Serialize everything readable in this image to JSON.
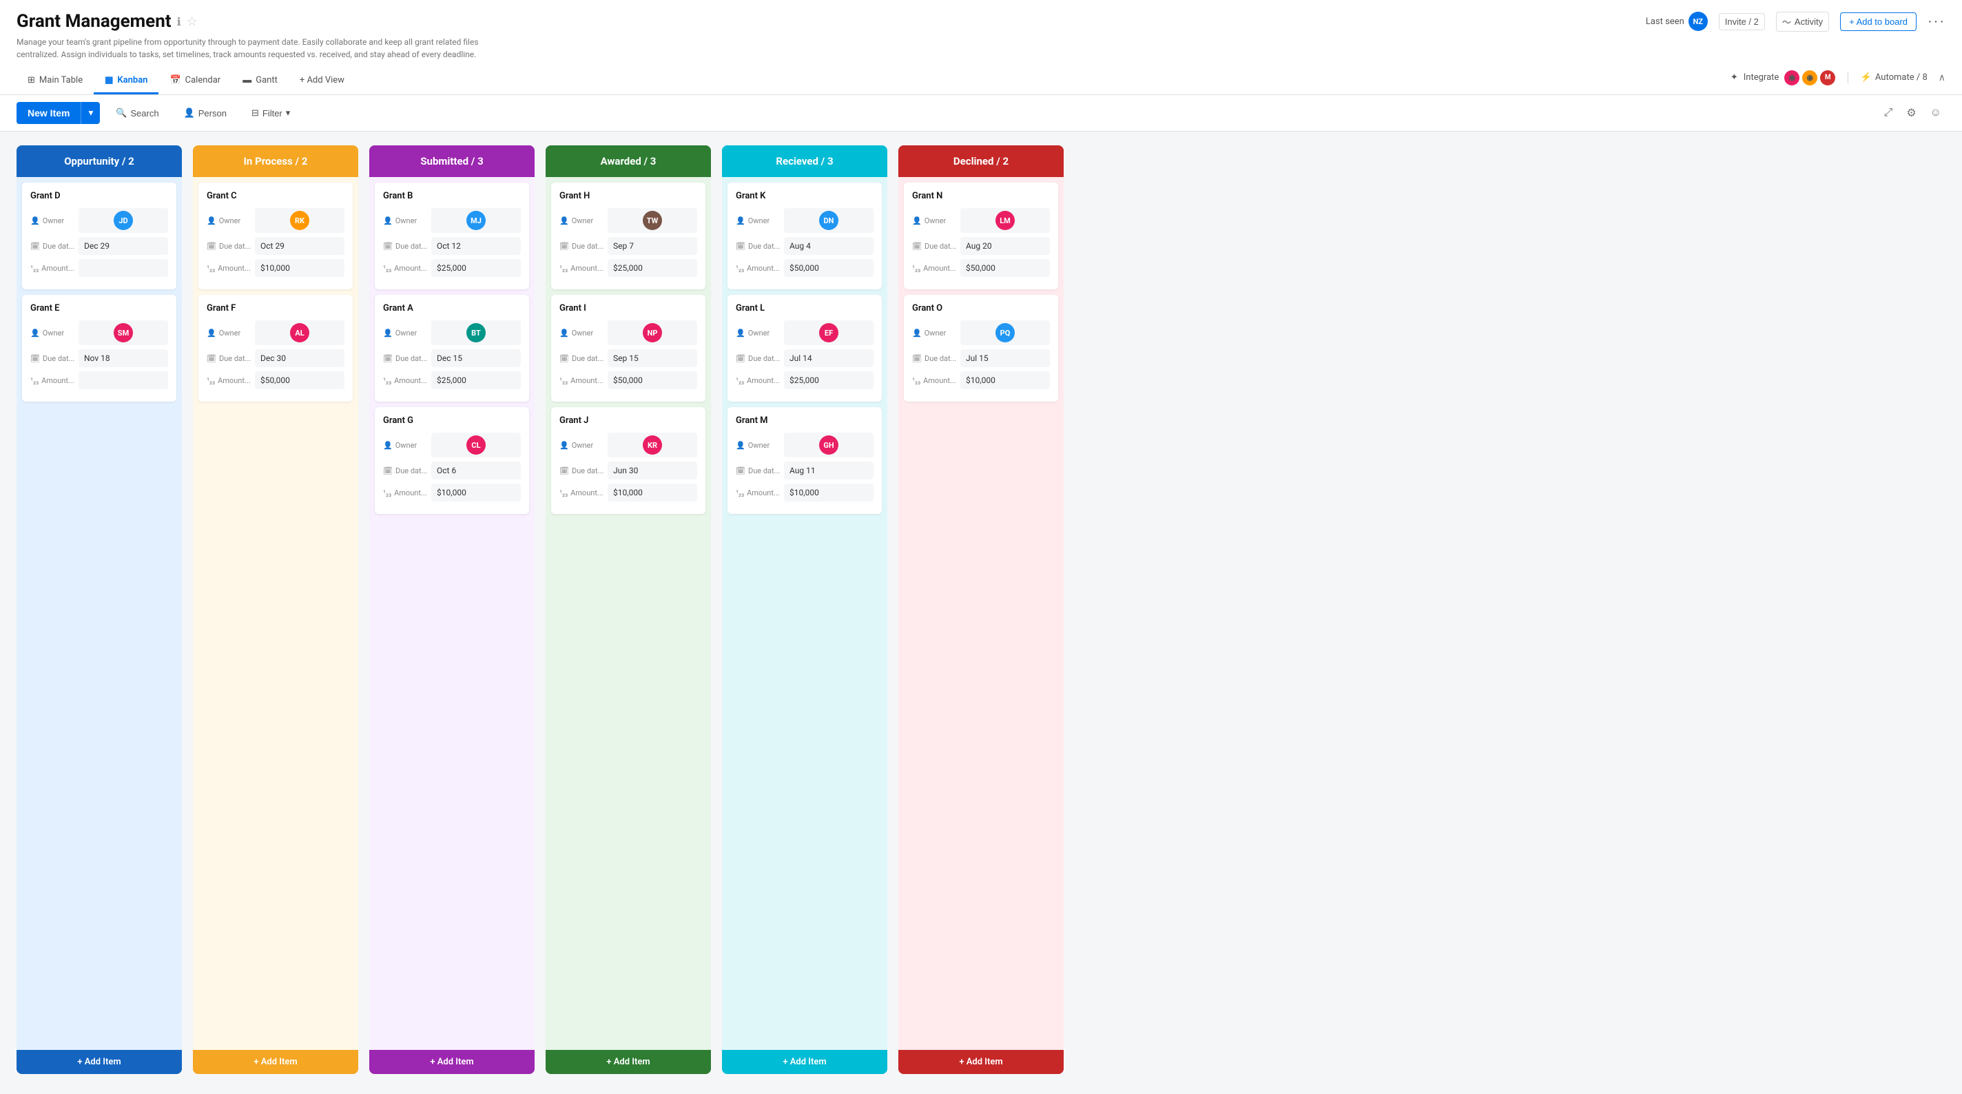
{
  "page": {
    "title": "Grant Management",
    "description": "Manage your team's grant pipeline from opportunity through to payment date. Easily collaborate and keep all grant related files centralized. Assign individuals to tasks, set timelines, track amounts requested vs. received, and stay ahead of every deadline.",
    "last_seen_label": "Last seen",
    "invite_label": "Invite / 2",
    "activity_label": "Activity",
    "add_board_label": "+ Add to board"
  },
  "nav": {
    "tabs": [
      {
        "id": "main-table",
        "label": "Main Table",
        "icon": "grid"
      },
      {
        "id": "kanban",
        "label": "Kanban",
        "icon": "kanban",
        "active": true
      },
      {
        "id": "calendar",
        "label": "Calendar",
        "icon": "calendar"
      },
      {
        "id": "gantt",
        "label": "Gantt",
        "icon": "gantt"
      }
    ],
    "add_view_label": "+ Add View"
  },
  "toolbar": {
    "new_item_label": "New Item",
    "search_label": "Search",
    "person_label": "Person",
    "filter_label": "Filter",
    "integrate_label": "Integrate",
    "automate_label": "Automate / 8"
  },
  "columns": [
    {
      "id": "opportunity",
      "title": "Oppurtunity / 2",
      "color_class": "col-opportunity",
      "add_label": "+ Add Item",
      "cards": [
        {
          "id": "grant-d",
          "title": "Grant D",
          "owner_label": "Owner",
          "due_label": "Due dat...",
          "amount_label": "Amount...",
          "due_value": "Dec 29",
          "amount_value": "",
          "avatar_color": "av-blue",
          "avatar_initials": "JD"
        },
        {
          "id": "grant-e",
          "title": "Grant E",
          "owner_label": "Owner",
          "due_label": "Due dat...",
          "amount_label": "Amount...",
          "due_value": "Nov 18",
          "amount_value": "",
          "avatar_color": "av-pink",
          "avatar_initials": "SM"
        }
      ]
    },
    {
      "id": "inprocess",
      "title": "In Process / 2",
      "color_class": "col-inprocess",
      "add_label": "+ Add Item",
      "cards": [
        {
          "id": "grant-c",
          "title": "Grant C",
          "owner_label": "Owner",
          "due_label": "Due dat...",
          "amount_label": "Amount...",
          "due_value": "Oct 29",
          "amount_value": "$10,000",
          "avatar_color": "av-orange",
          "avatar_initials": "RK"
        },
        {
          "id": "grant-f",
          "title": "Grant F",
          "owner_label": "Owner",
          "due_label": "Due dat...",
          "amount_label": "Amount...",
          "due_value": "Dec 30",
          "amount_value": "$50,000",
          "avatar_color": "av-pink",
          "avatar_initials": "AL"
        }
      ]
    },
    {
      "id": "submitted",
      "title": "Submitted / 3",
      "color_class": "col-submitted",
      "add_label": "+ Add Item",
      "cards": [
        {
          "id": "grant-b",
          "title": "Grant B",
          "owner_label": "Owner",
          "due_label": "Due dat...",
          "amount_label": "Amount...",
          "due_value": "Oct 12",
          "amount_value": "$25,000",
          "avatar_color": "av-blue",
          "avatar_initials": "MJ"
        },
        {
          "id": "grant-a",
          "title": "Grant A",
          "owner_label": "Owner",
          "due_label": "Due dat...",
          "amount_label": "Amount...",
          "due_value": "Dec 15",
          "amount_value": "$25,000",
          "avatar_color": "av-teal",
          "avatar_initials": "BT"
        },
        {
          "id": "grant-g",
          "title": "Grant G",
          "owner_label": "Owner",
          "due_label": "Due dat...",
          "amount_label": "Amount...",
          "due_value": "Oct 6",
          "amount_value": "$10,000",
          "avatar_color": "av-pink",
          "avatar_initials": "CL"
        }
      ]
    },
    {
      "id": "awarded",
      "title": "Awarded / 3",
      "color_class": "col-awarded",
      "add_label": "+ Add Item",
      "cards": [
        {
          "id": "grant-h",
          "title": "Grant H",
          "owner_label": "Owner",
          "due_label": "Due dat...",
          "amount_label": "Amount...",
          "due_value": "Sep 7",
          "amount_value": "$25,000",
          "avatar_color": "av-brown",
          "avatar_initials": "TW"
        },
        {
          "id": "grant-i",
          "title": "Grant I",
          "owner_label": "Owner",
          "due_label": "Due dat...",
          "amount_label": "Amount...",
          "due_value": "Sep 15",
          "amount_value": "$50,000",
          "avatar_color": "av-pink",
          "avatar_initials": "NP"
        },
        {
          "id": "grant-j",
          "title": "Grant J",
          "owner_label": "Owner",
          "due_label": "Due dat...",
          "amount_label": "Amount...",
          "due_value": "Jun 30",
          "amount_value": "$10,000",
          "avatar_color": "av-pink",
          "avatar_initials": "KR"
        }
      ]
    },
    {
      "id": "received",
      "title": "Recieved / 3",
      "color_class": "col-received",
      "add_label": "+ Add Item",
      "cards": [
        {
          "id": "grant-k",
          "title": "Grant K",
          "owner_label": "Owner",
          "due_label": "Due dat...",
          "amount_label": "Amount...",
          "due_value": "Aug 4",
          "amount_value": "$50,000",
          "avatar_color": "av-blue",
          "avatar_initials": "DN"
        },
        {
          "id": "grant-l",
          "title": "Grant L",
          "owner_label": "Owner",
          "due_label": "Due dat...",
          "amount_label": "Amount...",
          "due_value": "Jul 14",
          "amount_value": "$25,000",
          "avatar_color": "av-pink",
          "avatar_initials": "EF"
        },
        {
          "id": "grant-m",
          "title": "Grant M",
          "owner_label": "Owner",
          "due_label": "Due dat...",
          "amount_label": "Amount...",
          "due_value": "Aug 11",
          "amount_value": "$10,000",
          "avatar_color": "av-pink",
          "avatar_initials": "GH"
        }
      ]
    },
    {
      "id": "declined",
      "title": "Declined / 2",
      "color_class": "col-declined",
      "add_label": "+ Add Item",
      "cards": [
        {
          "id": "grant-n",
          "title": "Grant N",
          "owner_label": "Owner",
          "due_label": "Due dat...",
          "amount_label": "Amount...",
          "due_value": "Aug 20",
          "amount_value": "$50,000",
          "avatar_color": "av-pink",
          "avatar_initials": "LM"
        },
        {
          "id": "grant-o",
          "title": "Grant O",
          "owner_label": "Owner",
          "due_label": "Due dat...",
          "amount_label": "Amount...",
          "due_value": "Jul 15",
          "amount_value": "$10,000",
          "avatar_color": "av-blue",
          "avatar_initials": "PQ"
        }
      ]
    }
  ]
}
